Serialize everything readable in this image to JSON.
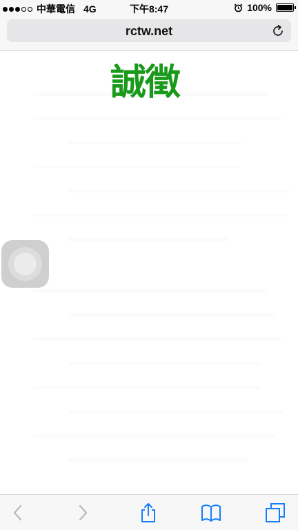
{
  "status_bar": {
    "carrier": "中華電信",
    "network": "4G",
    "time": "下午8:47",
    "battery": "100%",
    "battery_level": 1.0,
    "signal_strength": 3,
    "signal_max": 5
  },
  "address_bar": {
    "url": "rctw.net"
  },
  "page": {
    "logo_text": "誠徵"
  },
  "icons": {
    "reload": "reload-icon",
    "back": "chevron-left-icon",
    "forward": "chevron-right-icon",
    "share": "share-icon",
    "bookmarks": "book-icon",
    "tabs": "tabs-icon",
    "alarm": "alarm-icon"
  },
  "colors": {
    "accent": "#157efb",
    "logo_green": "#1a9a1a",
    "disabled": "#b8b8b8"
  }
}
